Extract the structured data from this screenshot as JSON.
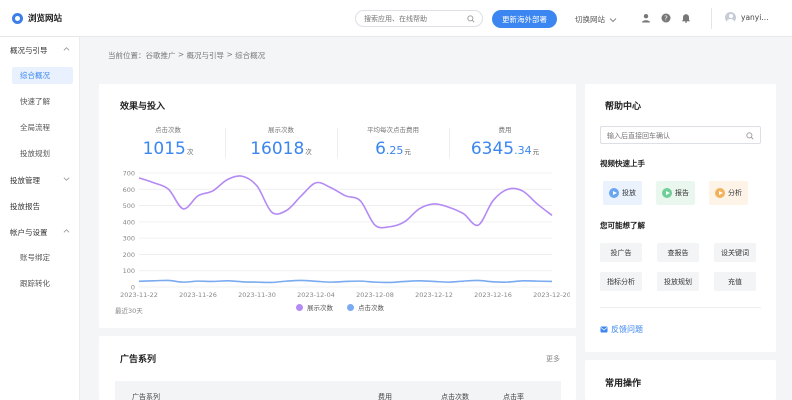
{
  "header": {
    "logo_text": "浏览网站",
    "search_placeholder": "搜索应用、在线帮助",
    "cta_label": "更新海外部署",
    "switch_site_label": "切换网站",
    "username": "yanyi..."
  },
  "sidebar": {
    "groups": [
      {
        "label": "概况与引导"
      },
      {
        "label": "投放管理"
      },
      {
        "label": "投放报告"
      },
      {
        "label": "帐户与设置"
      }
    ],
    "items": [
      {
        "label": "综合概况"
      },
      {
        "label": "快速了解"
      },
      {
        "label": "全局流程"
      },
      {
        "label": "投放规划"
      },
      {
        "label": "账号绑定"
      },
      {
        "label": "跟踪转化"
      }
    ]
  },
  "breadcrumb": {
    "prefix": "当前位置：",
    "items": [
      "谷歌推广",
      "概况与引导",
      "综合概况"
    ],
    "sep": " > "
  },
  "overview": {
    "title": "效果与投入",
    "stats": [
      {
        "label": "点击次数",
        "value": "1015",
        "frac": "",
        "unit": "次"
      },
      {
        "label": "展示次数",
        "value": "16018",
        "frac": "",
        "unit": "次"
      },
      {
        "label": "平均每次点击费用",
        "value": "6",
        "frac": ".25",
        "unit": "元"
      },
      {
        "label": "费用",
        "value": "6345",
        "frac": ".34",
        "unit": "元"
      }
    ],
    "range_label": "最近30天"
  },
  "chart_data": {
    "type": "line",
    "x": [
      "2023-11-22",
      "2023-11-23",
      "2023-11-24",
      "2023-11-25",
      "2023-11-26",
      "2023-11-27",
      "2023-11-28",
      "2023-11-29",
      "2023-11-30",
      "2023-12-01",
      "2023-12-02",
      "2023-12-03",
      "2023-12-04",
      "2023-12-05",
      "2023-12-06",
      "2023-12-07",
      "2023-12-08",
      "2023-12-09",
      "2023-12-10",
      "2023-12-11",
      "2023-12-12",
      "2023-12-13",
      "2023-12-14",
      "2023-12-15",
      "2023-12-16",
      "2023-12-17",
      "2023-12-18",
      "2023-12-19",
      "2023-12-20"
    ],
    "x_ticks": [
      "2023-11-22",
      "2023-11-26",
      "2023-11-30",
      "2023-12-04",
      "2023-12-08",
      "2023-12-12",
      "2023-12-16",
      "2023-12-20"
    ],
    "ylim": [
      0,
      700
    ],
    "y_ticks": [
      0,
      100,
      200,
      300,
      400,
      500,
      600,
      700
    ],
    "series": [
      {
        "name": "展示次数",
        "color": "#b48af4",
        "values": [
          670,
          640,
          600,
          480,
          560,
          590,
          660,
          680,
          620,
          460,
          470,
          560,
          640,
          610,
          560,
          530,
          380,
          370,
          400,
          480,
          510,
          490,
          450,
          380,
          530,
          600,
          590,
          510,
          440
        ]
      },
      {
        "name": "点击次数",
        "color": "#7aaaf0",
        "values": [
          35,
          38,
          40,
          30,
          36,
          34,
          38,
          32,
          30,
          28,
          36,
          40,
          35,
          30,
          34,
          36,
          30,
          28,
          34,
          38,
          34,
          30,
          36,
          40,
          32,
          30,
          38,
          36,
          34
        ]
      }
    ],
    "grid": true,
    "legend": "bottom-center"
  },
  "ads": {
    "title": "广告系列",
    "more_label": "更多",
    "columns": [
      "广告系列",
      "费用",
      "点击次数",
      "点击率"
    ]
  },
  "help": {
    "title": "帮助中心",
    "input_placeholder": "输入后直接回车确认",
    "video_title": "视频快速上手",
    "videos": [
      {
        "label": "投放",
        "color": "#6aa6f0",
        "bg": "#e9f2fd"
      },
      {
        "label": "报告",
        "color": "#6fcf97",
        "bg": "#eaf7ef"
      },
      {
        "label": "分析",
        "color": "#f2b25c",
        "bg": "#fdf3e6"
      }
    ],
    "faq_title": "您可能想了解",
    "faq": [
      "投广告",
      "查报告",
      "设关键词",
      "指标分析",
      "投放规划",
      "充值"
    ],
    "feedback_label": "反馈问题"
  },
  "common": {
    "title": "常用操作"
  }
}
